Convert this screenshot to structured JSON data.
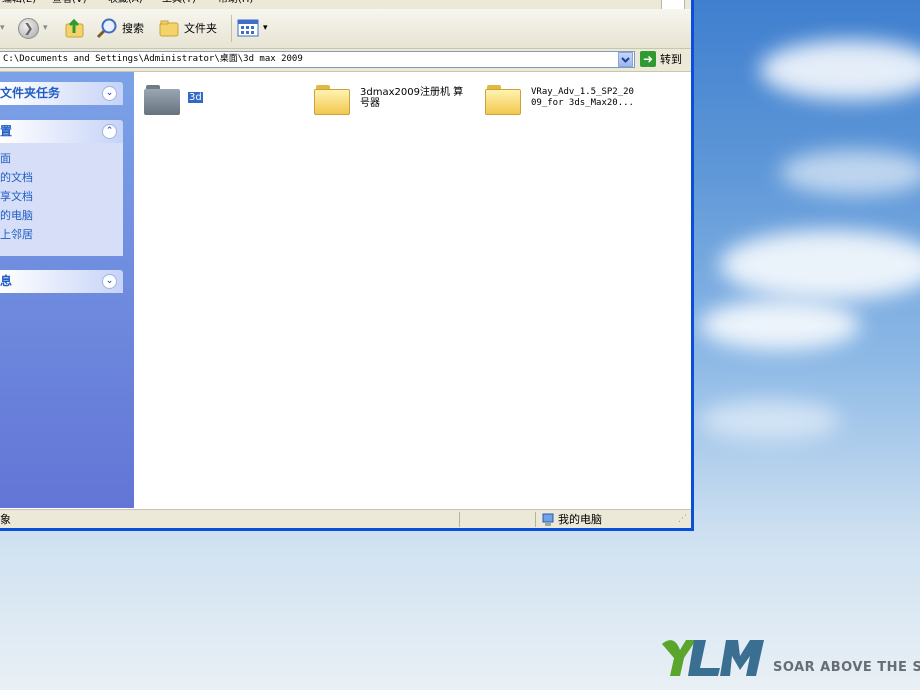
{
  "window": {
    "address_path": "C:\\Documents and Settings\\Administrator\\桌面\\3d max 2009",
    "go_label": "转到"
  },
  "toolbar": {
    "search_label": "搜索",
    "folders_label": "文件夹"
  },
  "left_pane": {
    "folder_tasks_title": "文件夹任务",
    "places_title": "置",
    "places_links": [
      "面",
      "的文档",
      "享文档",
      "的电脑",
      "上邻居"
    ],
    "details_title": "息"
  },
  "files": [
    {
      "name": "3d",
      "icon": "folder-gray-icon",
      "selected": true
    },
    {
      "name": "3dmax2009注册机 算号器",
      "icon": "folder-icon",
      "selected": false
    },
    {
      "name": "VRay_Adv_1.5_SP2_2009_for 3ds_Max20...",
      "icon": "folder-icon",
      "selected": false
    }
  ],
  "status_bar": {
    "left_text": "象",
    "right_text": "我的电脑"
  },
  "desktop": {
    "logo_mark": "YLMF",
    "logo_tagline": "SOAR ABOVE THE SKY"
  },
  "colors": {
    "xp_blue_border": "#0b4ed8",
    "task_pane_link": "#215dc6",
    "selection": "#316ac5"
  }
}
